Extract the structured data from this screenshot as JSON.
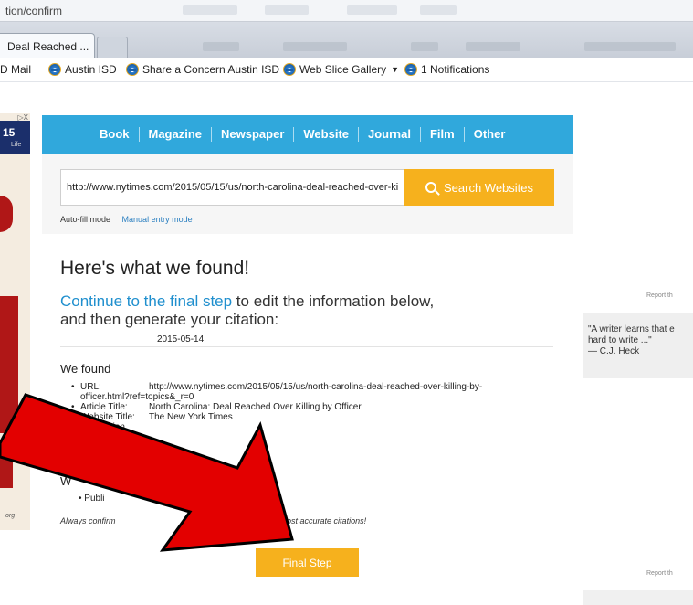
{
  "browser": {
    "address_text": "tion/confirm",
    "active_tab": "Deal Reached ...",
    "favorites": [
      {
        "label": "D Mail",
        "icon": false
      },
      {
        "label": "Austin ISD",
        "icon": true
      },
      {
        "label": "Share a Concern Austin ISD",
        "icon": true
      },
      {
        "label": "Web Slice Gallery",
        "icon": true,
        "dropdown": true
      },
      {
        "label": "1 Notifications",
        "icon": true
      }
    ]
  },
  "ad": {
    "badge": "15",
    "badge_sub": "Life",
    "close": "▷X",
    "footer": "org"
  },
  "source_types": [
    "Book",
    "Magazine",
    "Newspaper",
    "Website",
    "Journal",
    "Film",
    "Other"
  ],
  "search": {
    "url_value": "http://www.nytimes.com/2015/05/15/us/north-carolina-deal-reached-over-killing",
    "button_label": "Search Websites",
    "mode_auto": "Auto-fill mode",
    "mode_manual": "Manual entry mode"
  },
  "results": {
    "title": "Here's what we found!",
    "continue_link": "Continue to the final step",
    "continue_rest": " to edit the information below,",
    "continue_line2": "and then generate your citation:",
    "we_found": "We found",
    "fields": [
      {
        "label": "URL:",
        "value": "http://www.nytimes.com/2015/05/15/us/north-carolina-deal-reached-over-killing-by-",
        "value2": "officer.html?ref=topics&_r=0"
      },
      {
        "label": "Article Title:",
        "value": "North Carolina: Deal Reached Over Killing by Officer"
      },
      {
        "label": "Website Title:",
        "value": "The New York Times"
      },
      {
        "label": "Publication",
        "value": ""
      }
    ],
    "date": "2015-05-14",
    "we_letter": "W",
    "pub_bullet": "Publi",
    "confirm_note_start": "Always confirm",
    "confirm_note_end": "ate the most accurate citations!",
    "final_button": "Final Step"
  },
  "sidebar": {
    "report_label": "Report th",
    "quote_line1": "\"A writer learns that e",
    "quote_line2": "hard to write ...\"",
    "quote_author": "— C.J. Heck"
  },
  "colors": {
    "accent_blue": "#30a8dc",
    "button_orange": "#f6b11d",
    "link_blue": "#1f8fce",
    "arrow_red": "#e30000"
  }
}
